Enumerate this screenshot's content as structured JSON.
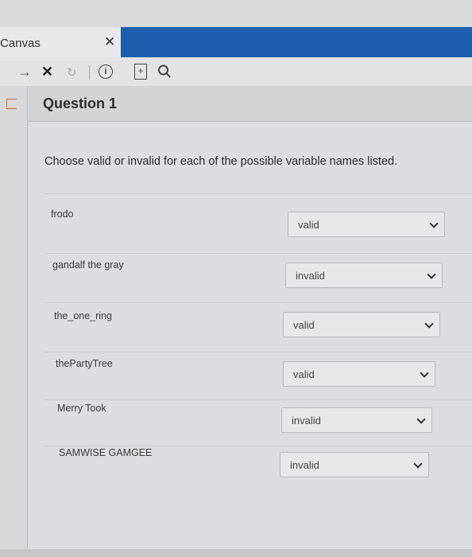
{
  "tab": {
    "title": "Canvas",
    "close_glyph": "✕"
  },
  "toolbar": {
    "forward_glyph": "→",
    "stop_glyph": "✕",
    "reload_glyph": "↻",
    "info_glyph": "i",
    "doc_glyph": "+",
    "icons": [
      "forward-icon",
      "stop-icon",
      "reload-icon",
      "info-icon",
      "document-icon",
      "search-icon"
    ]
  },
  "question": {
    "title": "Question 1",
    "prompt": "Choose valid or invalid for each of the possible variable names listed.",
    "rows": [
      {
        "name": "frodo",
        "selected": "valid"
      },
      {
        "name": "gandalf the gray",
        "selected": "invalid"
      },
      {
        "name": "the_one_ring",
        "selected": "valid"
      },
      {
        "name": "thePartyTree",
        "selected": "valid"
      },
      {
        "name": "Merry Took",
        "selected": "invalid"
      },
      {
        "name": "SAMWISE GAMGEE",
        "selected": "invalid"
      }
    ]
  },
  "colors": {
    "accent": "#1d5fae",
    "flag": "#e46a1f"
  }
}
